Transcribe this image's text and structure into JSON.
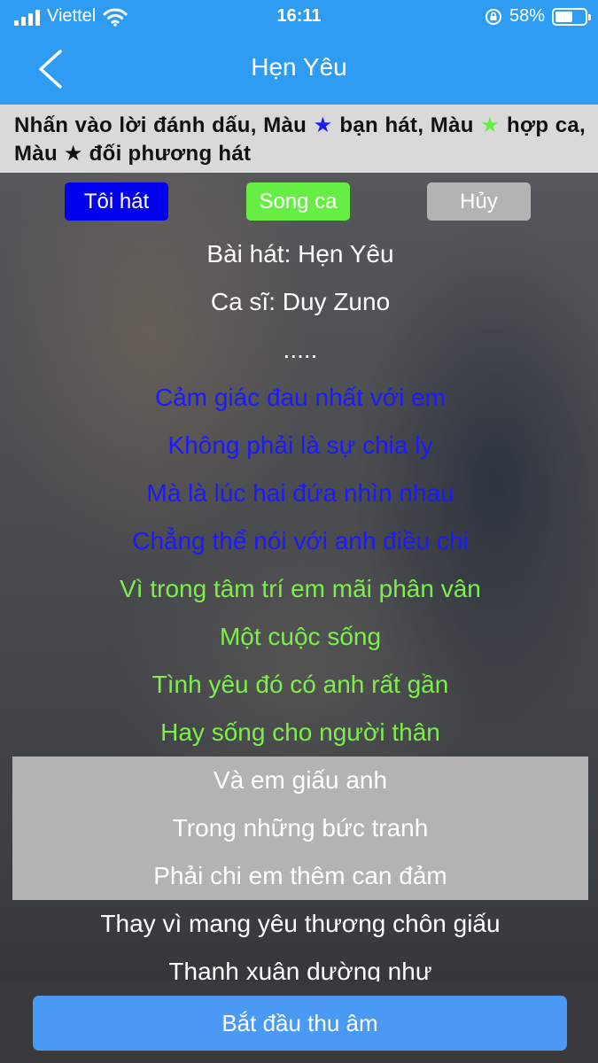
{
  "status_bar": {
    "carrier": "Viettel",
    "time": "16:11",
    "battery_text": "58%",
    "battery_level": 0.58
  },
  "nav": {
    "title": "Hẹn Yêu",
    "back_icon": "chevron-left-icon"
  },
  "instruction": {
    "part1": "Nhấn vào lời đánh dấu, Màu",
    "part2": "bạn hát, Màu",
    "part3": "hợp ca, Màu",
    "part4": "đối phương hát",
    "star_glyph": "★",
    "colors": {
      "me": "#1a1aff",
      "duet": "#66ee44",
      "partner": "#111111"
    }
  },
  "mode_buttons": {
    "me": "Tôi hát",
    "duet": "Song ca",
    "cancel": "Hủy"
  },
  "lyrics": [
    {
      "text": "Bài hát: Hẹn Yêu",
      "style": "white"
    },
    {
      "text": "Ca sĩ: Duy Zuno",
      "style": "white"
    },
    {
      "text": ".....",
      "style": "white"
    },
    {
      "text": "Cảm giác đau nhất với em",
      "style": "blue"
    },
    {
      "text": "Không phải là sự chia ly",
      "style": "blue"
    },
    {
      "text": "Mà là lúc hai đứa nhìn nhau",
      "style": "blue"
    },
    {
      "text": "Chẳng thể nói với anh điều chi",
      "style": "blue"
    },
    {
      "text": "Vì trong tâm trí em mãi phân vân",
      "style": "green"
    },
    {
      "text": "Một cuộc sống",
      "style": "green"
    },
    {
      "text": "Tình yêu đó có anh rất gần",
      "style": "green"
    },
    {
      "text": "Hay sống cho người thân",
      "style": "green"
    },
    {
      "text": "Và em giấu anh",
      "style": "sel"
    },
    {
      "text": "Trong những bức tranh",
      "style": "sel"
    },
    {
      "text": "Phải chi em thêm can đảm",
      "style": "sel"
    },
    {
      "text": "Thay vì mang yêu thương chôn giấu",
      "style": "white"
    },
    {
      "text": "Thanh xuân dường như",
      "style": "white"
    }
  ],
  "bottom": {
    "record_label": "Bắt đầu thu âm"
  }
}
